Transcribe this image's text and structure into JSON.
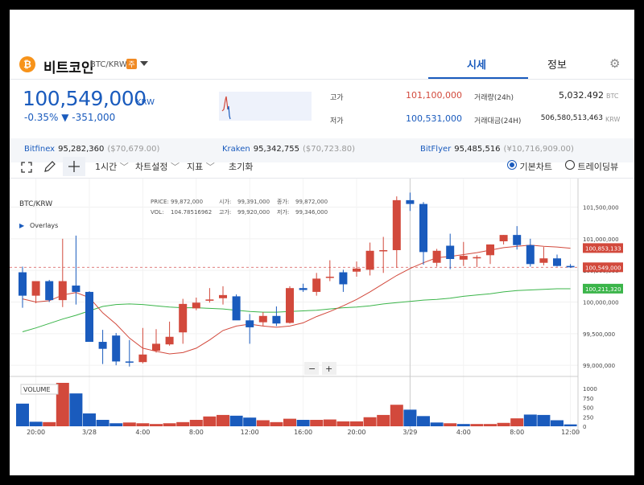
{
  "header": {
    "coin_logo": "₿",
    "coin_name": "비트코인",
    "pair": "BTC/KRW",
    "badge": "주",
    "tabs": [
      {
        "label": "시세",
        "active": true
      },
      {
        "label": "정보",
        "active": false
      }
    ],
    "settings_icon": "gear-icon"
  },
  "price": {
    "value": "100,549,000",
    "unit": "KRW",
    "change": "-0.35% ▼ -351,000"
  },
  "stats": {
    "high_label": "고가",
    "high": "101,100,000",
    "low_label": "저가",
    "low": "100,531,000",
    "volume_label": "거래량(24h)",
    "volume": "5,032.492",
    "volume_unit": "BTC",
    "amount_label": "거래대금(24H)",
    "amount": "506,580,513,463",
    "amount_unit": "KRW"
  },
  "exchanges": [
    {
      "name": "Bitfinex",
      "value": "95,282,360",
      "sub": "($70,679.00)"
    },
    {
      "name": "Kraken",
      "value": "95,342,755",
      "sub": "($70,723.80)"
    },
    {
      "name": "BitFlyer",
      "value": "95,485,516",
      "sub": "(¥10,716,909.00)"
    }
  ],
  "toolbar": {
    "interval": "1시간",
    "chart_settings": "차트설정",
    "indicators": "지표",
    "reset": "초기화",
    "view_basic": "기본차트",
    "view_trading": "트레이딩뷰"
  },
  "chart": {
    "symbol": "BTC/KRW",
    "overlays": "Overlays",
    "info": {
      "price_label": "PRICE:",
      "price": "99,872,000",
      "open_label": "시가:",
      "open": "99,391,000",
      "close_label": "종가:",
      "close": "99,872,000",
      "vol_label": "VOL:",
      "vol": "104.78516962",
      "high_label": "고가:",
      "high": "99,920,000",
      "low_label": "저가:",
      "low": "99,346,000"
    },
    "price_ticks": [
      "101,500,000",
      "101,000,000",
      "100,500,000",
      "100,000,000",
      "99,500,000",
      "99,000,000"
    ],
    "price_tick_values": [
      101500000,
      101000000,
      100500000,
      100000000,
      99500000,
      99000000
    ],
    "price_range": [
      98900000,
      101850000
    ],
    "price_tags": [
      {
        "label": "100,853,133",
        "value": 100853133,
        "color": "#d2493c"
      },
      {
        "label": "100,549,000",
        "value": 100549000,
        "color": "#d2493c"
      },
      {
        "label": "100,211,320",
        "value": 100211320,
        "color": "#3bb54a"
      }
    ],
    "volume_label": "VOLUME",
    "volume_ticks": [
      "1000",
      "750",
      "500",
      "250",
      "0"
    ],
    "volume_tick_values": [
      1000,
      750,
      500,
      250,
      0
    ],
    "volume_max": 1150,
    "x_labels": [
      "20:00",
      "3/28",
      "4:00",
      "8:00",
      "12:00",
      "16:00",
      "20:00",
      "3/29",
      "4:00",
      "8:00",
      "12:00"
    ],
    "x_label_candle_index": [
      1,
      5,
      9,
      13,
      17,
      21,
      25,
      29,
      33,
      37,
      41
    ],
    "zoom_out": "−",
    "zoom_in": "+"
  },
  "chart_data": {
    "type": "candlestick",
    "up_color": "#d2493c",
    "down_color": "#1a5bbd",
    "ma_short_color": "#d2493c",
    "ma_long_color": "#3bb54a",
    "candles": [
      {
        "o": 100470000,
        "h": 100560000,
        "l": 99910000,
        "c": 100100000
      },
      {
        "o": 100100000,
        "h": 100310000,
        "l": 99980000,
        "c": 100330000
      },
      {
        "o": 100330000,
        "h": 100350000,
        "l": 100000000,
        "c": 100030000
      },
      {
        "o": 100030000,
        "h": 101000000,
        "l": 99920000,
        "c": 100330000
      },
      {
        "o": 100260000,
        "h": 101050000,
        "l": 99960000,
        "c": 100160000
      },
      {
        "o": 100160000,
        "h": 100170000,
        "l": 99420000,
        "c": 99370000
      },
      {
        "o": 99370000,
        "h": 99560000,
        "l": 99020000,
        "c": 99260000
      },
      {
        "o": 99470000,
        "h": 99510000,
        "l": 99000000,
        "c": 99060000
      },
      {
        "o": 99060000,
        "h": 99400000,
        "l": 98980000,
        "c": 99050000
      },
      {
        "o": 99050000,
        "h": 99590000,
        "l": 99030000,
        "c": 99170000
      },
      {
        "o": 99230000,
        "h": 99570000,
        "l": 99200000,
        "c": 99340000
      },
      {
        "o": 99330000,
        "h": 99690000,
        "l": 99310000,
        "c": 99450000
      },
      {
        "o": 99520000,
        "h": 100050000,
        "l": 99340000,
        "c": 99970000
      },
      {
        "o": 99900000,
        "h": 100070000,
        "l": 99870000,
        "c": 99990000
      },
      {
        "o": 100020000,
        "h": 100220000,
        "l": 99990000,
        "c": 100040000
      },
      {
        "o": 100060000,
        "h": 100250000,
        "l": 99960000,
        "c": 100110000
      },
      {
        "o": 100090000,
        "h": 100120000,
        "l": 99820000,
        "c": 99710000
      },
      {
        "o": 99710000,
        "h": 99810000,
        "l": 99340000,
        "c": 99600000
      },
      {
        "o": 99680000,
        "h": 99840000,
        "l": 99620000,
        "c": 99780000
      },
      {
        "o": 99780000,
        "h": 99930000,
        "l": 99620000,
        "c": 99660000
      },
      {
        "o": 99670000,
        "h": 100250000,
        "l": 99660000,
        "c": 100220000
      },
      {
        "o": 100220000,
        "h": 100290000,
        "l": 100160000,
        "c": 100190000
      },
      {
        "o": 100160000,
        "h": 100460000,
        "l": 100100000,
        "c": 100370000
      },
      {
        "o": 100390000,
        "h": 100660000,
        "l": 100330000,
        "c": 100400000
      },
      {
        "o": 100470000,
        "h": 100510000,
        "l": 100160000,
        "c": 100280000
      },
      {
        "o": 100480000,
        "h": 100640000,
        "l": 100400000,
        "c": 100530000
      },
      {
        "o": 100510000,
        "h": 100940000,
        "l": 100420000,
        "c": 100810000
      },
      {
        "o": 100820000,
        "h": 101030000,
        "l": 100460000,
        "c": 100820000
      },
      {
        "o": 100820000,
        "h": 101670000,
        "l": 100540000,
        "c": 101610000
      },
      {
        "o": 101610000,
        "h": 101730000,
        "l": 101440000,
        "c": 101550000
      },
      {
        "o": 101550000,
        "h": 101580000,
        "l": 100590000,
        "c": 100790000
      },
      {
        "o": 100620000,
        "h": 100840000,
        "l": 100560000,
        "c": 100810000
      },
      {
        "o": 100890000,
        "h": 101080000,
        "l": 100520000,
        "c": 100680000
      },
      {
        "o": 100670000,
        "h": 100950000,
        "l": 100570000,
        "c": 100730000
      },
      {
        "o": 100690000,
        "h": 100740000,
        "l": 100550000,
        "c": 100710000
      },
      {
        "o": 100740000,
        "h": 100910000,
        "l": 100600000,
        "c": 100910000
      },
      {
        "o": 100960000,
        "h": 101060000,
        "l": 100910000,
        "c": 101060000
      },
      {
        "o": 101060000,
        "h": 101200000,
        "l": 100830000,
        "c": 100900000
      },
      {
        "o": 100900000,
        "h": 101000000,
        "l": 100560000,
        "c": 100600000
      },
      {
        "o": 100620000,
        "h": 100870000,
        "l": 100580000,
        "c": 100690000
      },
      {
        "o": 100690000,
        "h": 100750000,
        "l": 100560000,
        "c": 100570000
      },
      {
        "o": 100570000,
        "h": 100600000,
        "l": 100540000,
        "c": 100549000
      }
    ],
    "ma_short": [
      100050000,
      100000000,
      100020000,
      100110000,
      100150000,
      100070000,
      99830000,
      99650000,
      99430000,
      99270000,
      99220000,
      99180000,
      99200000,
      99270000,
      99400000,
      99550000,
      99620000,
      99650000,
      99620000,
      99600000,
      99620000,
      99670000,
      99770000,
      99850000,
      99940000,
      100040000,
      100160000,
      100290000,
      100420000,
      100530000,
      100620000,
      100700000,
      100720000,
      100750000,
      100780000,
      100820000,
      100860000,
      100880000,
      100900000,
      100880000,
      100870000,
      100850000
    ],
    "ma_long": [
      99530000,
      99590000,
      99660000,
      99730000,
      99790000,
      99860000,
      99930000,
      99960000,
      99970000,
      99960000,
      99940000,
      99920000,
      99910000,
      99910000,
      99900000,
      99890000,
      99870000,
      99850000,
      99840000,
      99840000,
      99850000,
      99860000,
      99870000,
      99890000,
      99910000,
      99920000,
      99940000,
      99970000,
      99990000,
      100010000,
      100030000,
      100040000,
      100060000,
      100090000,
      100110000,
      100130000,
      100160000,
      100180000,
      100190000,
      100200000,
      100210000,
      100210000
    ],
    "volume": [
      {
        "v": 600,
        "d": "down"
      },
      {
        "v": 120,
        "d": "down"
      },
      {
        "v": 110,
        "d": "up"
      },
      {
        "v": 1150,
        "d": "up"
      },
      {
        "v": 870,
        "d": "down"
      },
      {
        "v": 340,
        "d": "down"
      },
      {
        "v": 170,
        "d": "down"
      },
      {
        "v": 80,
        "d": "down"
      },
      {
        "v": 100,
        "d": "up"
      },
      {
        "v": 80,
        "d": "up"
      },
      {
        "v": 60,
        "d": "up"
      },
      {
        "v": 80,
        "d": "up"
      },
      {
        "v": 110,
        "d": "up"
      },
      {
        "v": 170,
        "d": "up"
      },
      {
        "v": 260,
        "d": "up"
      },
      {
        "v": 300,
        "d": "up"
      },
      {
        "v": 280,
        "d": "down"
      },
      {
        "v": 230,
        "d": "down"
      },
      {
        "v": 160,
        "d": "up"
      },
      {
        "v": 110,
        "d": "up"
      },
      {
        "v": 200,
        "d": "up"
      },
      {
        "v": 170,
        "d": "down"
      },
      {
        "v": 170,
        "d": "up"
      },
      {
        "v": 180,
        "d": "up"
      },
      {
        "v": 130,
        "d": "up"
      },
      {
        "v": 130,
        "d": "up"
      },
      {
        "v": 240,
        "d": "up"
      },
      {
        "v": 300,
        "d": "up"
      },
      {
        "v": 570,
        "d": "up"
      },
      {
        "v": 440,
        "d": "down"
      },
      {
        "v": 270,
        "d": "down"
      },
      {
        "v": 100,
        "d": "down"
      },
      {
        "v": 80,
        "d": "up"
      },
      {
        "v": 60,
        "d": "down"
      },
      {
        "v": 60,
        "d": "up"
      },
      {
        "v": 60,
        "d": "up"
      },
      {
        "v": 90,
        "d": "up"
      },
      {
        "v": 210,
        "d": "up"
      },
      {
        "v": 310,
        "d": "down"
      },
      {
        "v": 300,
        "d": "down"
      },
      {
        "v": 160,
        "d": "down"
      },
      {
        "v": 50,
        "d": "down"
      }
    ]
  }
}
